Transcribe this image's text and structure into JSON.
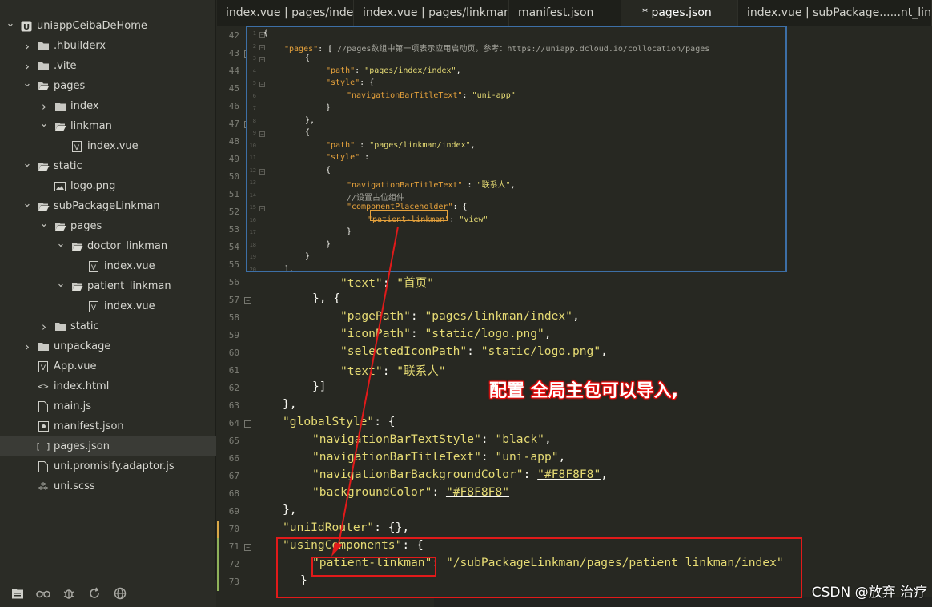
{
  "colors": {
    "editor_bg": "#272822",
    "string": "#e6db74",
    "json_key_highlight": "#e6a23c",
    "popup_border": "#3d6fa6",
    "annotation_red": "#e11a1a",
    "selection_bg": "#3a3b36"
  },
  "tree": [
    {
      "label": "uniappCeibaDeHome",
      "icon": "project-icon",
      "chevron": "down",
      "depth": 0
    },
    {
      "label": ".hbuilderx",
      "icon": "folder-icon",
      "chevron": "right",
      "depth": 1
    },
    {
      "label": ".vite",
      "icon": "folder-icon",
      "chevron": "right",
      "depth": 1
    },
    {
      "label": "pages",
      "icon": "folder-open-icon",
      "chevron": "down",
      "depth": 1
    },
    {
      "label": "index",
      "icon": "folder-icon",
      "chevron": "right",
      "depth": 2
    },
    {
      "label": "linkman",
      "icon": "folder-open-icon",
      "chevron": "down",
      "depth": 2
    },
    {
      "label": "index.vue",
      "icon": "vue-file-icon",
      "chevron": "none",
      "depth": 3
    },
    {
      "label": "static",
      "icon": "folder-open-icon",
      "chevron": "down",
      "depth": 1
    },
    {
      "label": "logo.png",
      "icon": "image-file-icon",
      "chevron": "none",
      "depth": 2
    },
    {
      "label": "subPackageLinkman",
      "icon": "folder-open-icon",
      "chevron": "down",
      "depth": 1
    },
    {
      "label": "pages",
      "icon": "folder-open-icon",
      "chevron": "down",
      "depth": 2
    },
    {
      "label": "doctor_linkman",
      "icon": "folder-open-icon",
      "chevron": "down",
      "depth": 3
    },
    {
      "label": "index.vue",
      "icon": "vue-file-icon",
      "chevron": "none",
      "depth": 4
    },
    {
      "label": "patient_linkman",
      "icon": "folder-open-icon",
      "chevron": "down",
      "depth": 3
    },
    {
      "label": "index.vue",
      "icon": "vue-file-icon",
      "chevron": "none",
      "depth": 4
    },
    {
      "label": "static",
      "icon": "folder-icon",
      "chevron": "right",
      "depth": 2
    },
    {
      "label": "unpackage",
      "icon": "folder-icon",
      "chevron": "right",
      "depth": 1
    },
    {
      "label": "App.vue",
      "icon": "vue-file-icon",
      "chevron": "none",
      "depth": 1
    },
    {
      "label": "index.html",
      "icon": "html-file-icon",
      "chevron": "none",
      "depth": 1
    },
    {
      "label": "main.js",
      "icon": "js-file-icon",
      "chevron": "none",
      "depth": 1
    },
    {
      "label": "manifest.json",
      "icon": "manifest-file-icon",
      "chevron": "none",
      "depth": 1
    },
    {
      "label": "pages.json",
      "icon": "json-file-icon",
      "chevron": "none",
      "depth": 1,
      "selected": true
    },
    {
      "label": "uni.promisify.adaptor.js",
      "icon": "js-file-icon",
      "chevron": "none",
      "depth": 1
    },
    {
      "label": "uni.scss",
      "icon": "scss-file-icon",
      "chevron": "none",
      "depth": 1
    }
  ],
  "sidebar_bottom": [
    {
      "icon": "project-manager-icon"
    },
    {
      "icon": "plugin-icon"
    },
    {
      "icon": "debug-bug-icon"
    },
    {
      "icon": "refresh-icon"
    },
    {
      "icon": "globe-icon"
    }
  ],
  "tabs": [
    {
      "label": "index.vue | pages/index",
      "active": false
    },
    {
      "label": "index.vue | pages/linkman",
      "active": false
    },
    {
      "label": "manifest.json",
      "active": false
    },
    {
      "label": "* pages.json",
      "active": true
    },
    {
      "label": "index.vue | subPackage......nt_linkma",
      "active": false
    }
  ],
  "gutter_numbers": [
    "42",
    "43",
    "44",
    "45",
    "46",
    "47",
    "48",
    "49",
    "50",
    "51",
    "52",
    "53",
    "54",
    "55",
    "56",
    "57",
    "58",
    "59",
    "60",
    "61",
    "62",
    "63",
    "64",
    "65",
    "66",
    "67",
    "68",
    "69",
    "70",
    "71",
    "72",
    "73"
  ],
  "code_lines": [
    {
      "parts": [
        {
          "t": "\"text\"",
          "c": "k"
        },
        {
          "t": ": ",
          "c": "p"
        },
        {
          "t": "\"首页\"",
          "c": "k"
        }
      ]
    },
    {
      "parts": [
        {
          "t": "}, {",
          "c": "p"
        }
      ]
    },
    {
      "parts": [
        {
          "t": "\"pagePath\"",
          "c": "k"
        },
        {
          "t": ": ",
          "c": "p"
        },
        {
          "t": "\"pages/linkman/index\"",
          "c": "k"
        },
        {
          "t": ",",
          "c": "p"
        }
      ]
    },
    {
      "parts": [
        {
          "t": "\"iconPath\"",
          "c": "k"
        },
        {
          "t": ": ",
          "c": "p"
        },
        {
          "t": "\"static/logo.png\"",
          "c": "k"
        },
        {
          "t": ",",
          "c": "p"
        }
      ]
    },
    {
      "parts": [
        {
          "t": "\"selectedIconPath\"",
          "c": "k"
        },
        {
          "t": ": ",
          "c": "p"
        },
        {
          "t": "\"static/logo.png\"",
          "c": "k"
        },
        {
          "t": ",",
          "c": "p"
        }
      ]
    },
    {
      "parts": [
        {
          "t": "\"text\"",
          "c": "k"
        },
        {
          "t": ": ",
          "c": "p"
        },
        {
          "t": "\"联系人\"",
          "c": "k"
        }
      ]
    },
    {
      "parts": [
        {
          "t": "}]",
          "c": "p"
        }
      ]
    },
    {
      "parts": [
        {
          "t": "},",
          "c": "p"
        }
      ]
    },
    {
      "parts": [
        {
          "t": "\"globalStyle\"",
          "c": "k"
        },
        {
          "t": ": {",
          "c": "p"
        }
      ]
    },
    {
      "parts": [
        {
          "t": "\"navigationBarTextStyle\"",
          "c": "k"
        },
        {
          "t": ": ",
          "c": "p"
        },
        {
          "t": "\"black\"",
          "c": "k"
        },
        {
          "t": ",",
          "c": "p"
        }
      ]
    },
    {
      "parts": [
        {
          "t": "\"navigationBarTitleText\"",
          "c": "k"
        },
        {
          "t": ": ",
          "c": "p"
        },
        {
          "t": "\"uni-app\"",
          "c": "k"
        },
        {
          "t": ",",
          "c": "p"
        }
      ]
    },
    {
      "parts": [
        {
          "t": "\"navigationBarBackgroundColor\"",
          "c": "k"
        },
        {
          "t": ": ",
          "c": "p"
        },
        {
          "t": "\"#F8F8F8\"",
          "c": "k"
        },
        {
          "t": ",",
          "c": "p"
        }
      ]
    },
    {
      "parts": [
        {
          "t": "\"backgroundColor\"",
          "c": "k"
        },
        {
          "t": ": ",
          "c": "p"
        },
        {
          "t": "\"#F8F8F8\"",
          "c": "k"
        }
      ]
    },
    {
      "parts": [
        {
          "t": "},",
          "c": "p"
        }
      ]
    },
    {
      "parts": [
        {
          "t": "\"uniIdRouter\"",
          "c": "k"
        },
        {
          "t": ": {},",
          "c": "p"
        }
      ]
    },
    {
      "parts": [
        {
          "t": "\"usingComponents\"",
          "c": "k"
        },
        {
          "t": ": {",
          "c": "p"
        }
      ]
    },
    {
      "parts": [
        {
          "t": "\"patient-linkman\"",
          "c": "k"
        },
        {
          "t": ": ",
          "c": "p"
        },
        {
          "t": "\"/subPackageLinkman/pages/patient_linkman/index\"",
          "c": "k"
        }
      ]
    },
    {
      "parts": [
        {
          "t": "}",
          "c": "p"
        }
      ]
    }
  ],
  "popup": {
    "numbers": [
      "1",
      "2",
      "3",
      "4",
      "5",
      "6",
      "7",
      "8",
      "9",
      "10",
      "11",
      "12",
      "13",
      "14",
      "15",
      "16",
      "17",
      "18",
      "19",
      "20"
    ],
    "lines": [
      {
        "parts": [
          {
            "t": "{",
            "c": "p"
          }
        ]
      },
      {
        "parts": [
          {
            "t": "\"pages\"",
            "c": "pkey"
          },
          {
            "t": ": [ ",
            "c": "p"
          },
          {
            "t": "//pages数组中第一项表示应用启动页，参考：https://uniapp.dcloud.io/collocation/pages",
            "c": "pc"
          }
        ]
      },
      {
        "parts": [
          {
            "t": "{",
            "c": "p"
          }
        ]
      },
      {
        "parts": [
          {
            "t": "\"path\"",
            "c": "pkey"
          },
          {
            "t": ": ",
            "c": "p"
          },
          {
            "t": "\"pages/index/index\"",
            "c": "pk"
          },
          {
            "t": ",",
            "c": "p"
          }
        ]
      },
      {
        "parts": [
          {
            "t": "\"style\"",
            "c": "pkey"
          },
          {
            "t": ": {",
            "c": "p"
          }
        ]
      },
      {
        "parts": [
          {
            "t": "\"navigationBarTitleText\"",
            "c": "pkey"
          },
          {
            "t": ": ",
            "c": "p"
          },
          {
            "t": "\"uni-app\"",
            "c": "pk"
          }
        ]
      },
      {
        "parts": [
          {
            "t": "}",
            "c": "p"
          }
        ]
      },
      {
        "parts": [
          {
            "t": "},",
            "c": "p"
          }
        ]
      },
      {
        "parts": [
          {
            "t": "{",
            "c": "p"
          }
        ]
      },
      {
        "parts": [
          {
            "t": "\"path\"",
            "c": "pkey"
          },
          {
            "t": " : ",
            "c": "p"
          },
          {
            "t": "\"pages/linkman/index\"",
            "c": "pk"
          },
          {
            "t": ",",
            "c": "p"
          }
        ]
      },
      {
        "parts": [
          {
            "t": "\"style\"",
            "c": "pkey"
          },
          {
            "t": " :",
            "c": "p"
          }
        ]
      },
      {
        "parts": [
          {
            "t": "{",
            "c": "p"
          }
        ]
      },
      {
        "parts": [
          {
            "t": "\"navigationBarTitleText\"",
            "c": "pkey"
          },
          {
            "t": " : ",
            "c": "p"
          },
          {
            "t": "\"联系人\"",
            "c": "pk"
          },
          {
            "t": ",",
            "c": "p"
          }
        ]
      },
      {
        "parts": [
          {
            "t": "//设置占位组件",
            "c": "pc"
          }
        ]
      },
      {
        "parts": [
          {
            "t": "\"componentPlaceholder\"",
            "c": "pkey"
          },
          {
            "t": ": {",
            "c": "p"
          }
        ]
      },
      {
        "parts": [
          {
            "t": "\"patient-linkman\"",
            "c": "pkey"
          },
          {
            "t": ": ",
            "c": "p"
          },
          {
            "t": "\"view\"",
            "c": "pk"
          }
        ]
      },
      {
        "parts": [
          {
            "t": "}",
            "c": "p"
          }
        ]
      },
      {
        "parts": [
          {
            "t": "}",
            "c": "p"
          }
        ]
      },
      {
        "parts": [
          {
            "t": "}",
            "c": "p"
          }
        ]
      },
      {
        "parts": [
          {
            "t": "],",
            "c": "p"
          }
        ]
      }
    ]
  },
  "annotation": "配置  全局主包可以导入,",
  "watermark": "CSDN @放弃      治疗"
}
